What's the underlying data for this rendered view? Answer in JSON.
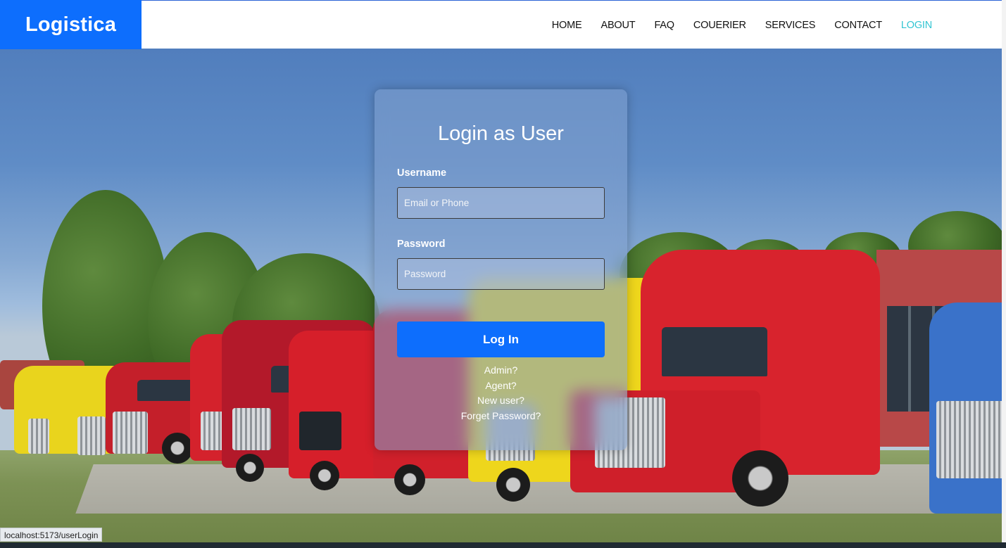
{
  "brand": {
    "name": "Logistica",
    "color": "#0d6efd"
  },
  "nav": {
    "items": [
      {
        "label": "HOME"
      },
      {
        "label": "ABOUT"
      },
      {
        "label": "FAQ"
      },
      {
        "label": "COUERIER"
      },
      {
        "label": "SERVICES"
      },
      {
        "label": "CONTACT"
      },
      {
        "label": "LOGIN",
        "active": true
      }
    ],
    "active_color": "#32c5d2"
  },
  "login": {
    "title": "Login as User",
    "username": {
      "label": "Username",
      "placeholder": "Email or Phone",
      "value": ""
    },
    "password": {
      "label": "Password",
      "placeholder": "Password",
      "value": ""
    },
    "submit_label": "Log In",
    "links": [
      "Admin?",
      "Agent?",
      "New user?",
      "Forget Password?"
    ]
  },
  "status_bar": {
    "url": "localhost:5173/userLogin"
  },
  "colors": {
    "primary": "#0d6efd",
    "navbar_bg": "#ffffff"
  }
}
